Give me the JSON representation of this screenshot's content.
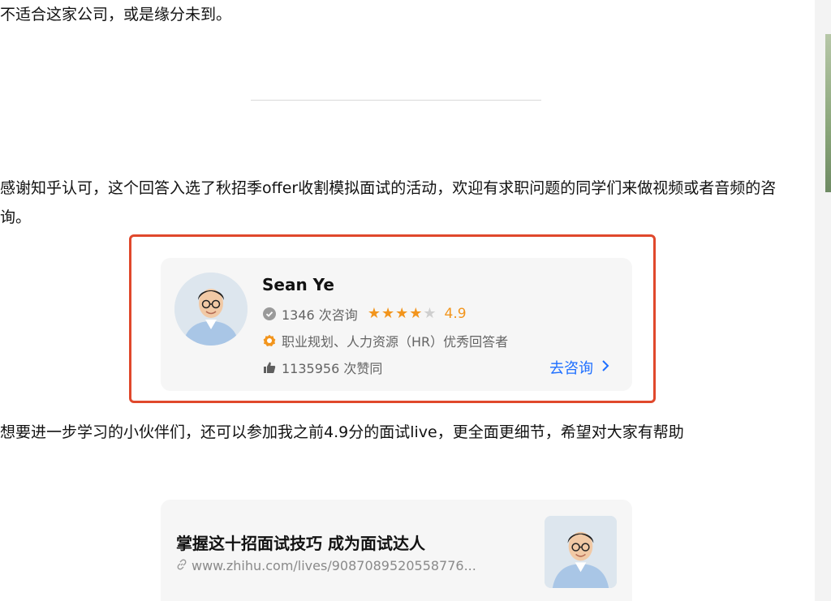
{
  "paragraphs": {
    "top": "不适合这家公司，或是缘分未到。",
    "thanks": "感谢知乎认可，这个回答入选了秋招季offer收割模拟面试的活动，欢迎有求职问题的同学们来做视频或者音频的咨询。",
    "more": "想要进一步学习的小伙伴们，还可以参加我之前4.9分的面试live，更全面更细节，希望对大家有帮助"
  },
  "consult_card": {
    "name": "Sean Ye",
    "consult_count": "1346 次咨询",
    "stars_filled": 4,
    "stars_total": 5,
    "rating": "4.9",
    "expertise": "职业规划、人力资源（HR）优秀回答者",
    "likes": "1135956 次赞同",
    "cta": "去咨询"
  },
  "live_card": {
    "title": "掌握这十招面试技巧 成为面试达人",
    "url": "www.zhihu.com/lives/9087089520558776..."
  },
  "colors": {
    "accent_blue": "#1e6fff",
    "star_orange": "#f2951d",
    "highlight_red": "#e0482c",
    "card_bg": "#f6f6f6"
  }
}
